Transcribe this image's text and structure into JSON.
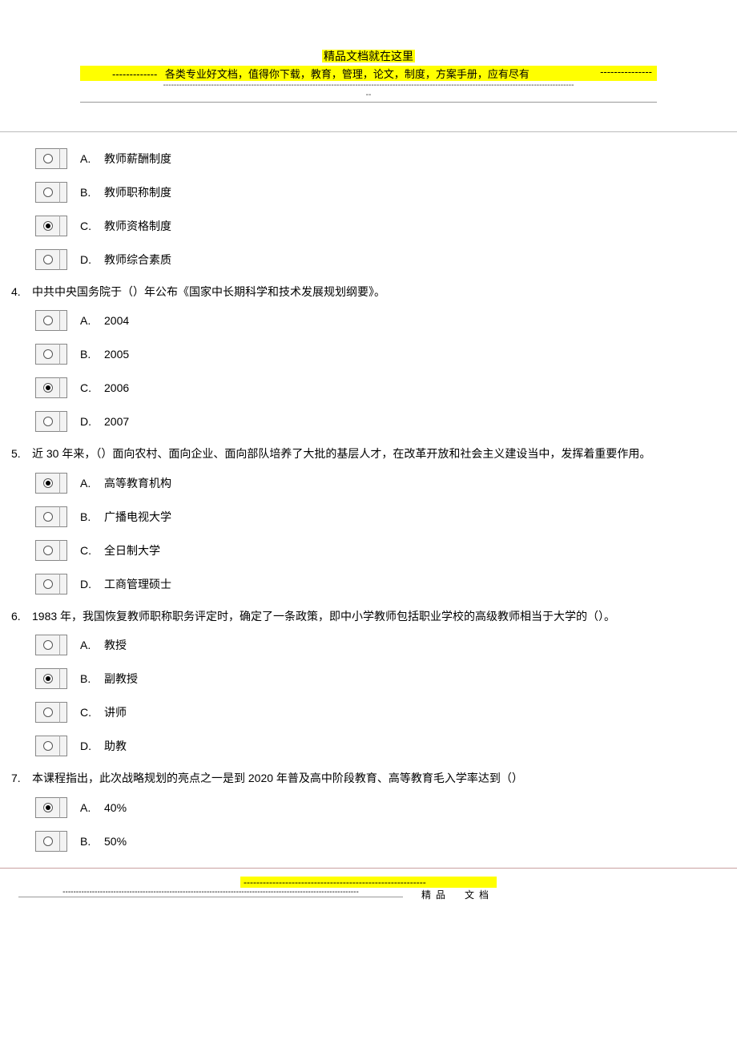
{
  "header": {
    "title": "精品文档就在这里",
    "dashes": "-------------",
    "sub": "各类专业好文档，值得你下载，教育，管理，论文，制度，方案手册，应有尽有",
    "dashes2": "---------------",
    "dotted": "----------------------------------------------------------------------------------------------------------------------------------------------------------",
    "dotted_tail": "--"
  },
  "questions": [
    {
      "num": "",
      "text": "",
      "options": [
        {
          "letter": "A.",
          "text": "教师薪酬制度",
          "selected": false
        },
        {
          "letter": "B.",
          "text": "教师职称制度",
          "selected": false
        },
        {
          "letter": "C.",
          "text": "教师资格制度",
          "selected": true
        },
        {
          "letter": "D.",
          "text": "教师综合素质",
          "selected": false
        }
      ]
    },
    {
      "num": "4.",
      "text": "中共中央国务院于（）年公布《国家中长期科学和技术发展规划纲要》。",
      "options": [
        {
          "letter": "A.",
          "text": "2004",
          "selected": false
        },
        {
          "letter": "B.",
          "text": "2005",
          "selected": false
        },
        {
          "letter": "C.",
          "text": "2006",
          "selected": true
        },
        {
          "letter": "D.",
          "text": "2007",
          "selected": false
        }
      ]
    },
    {
      "num": "5.",
      "text": "近 30 年来，（）面向农村、面向企业、面向部队培养了大批的基层人才，在改革开放和社会主义建设当中，发挥着重要作用。",
      "options": [
        {
          "letter": "A.",
          "text": "高等教育机构",
          "selected": true
        },
        {
          "letter": "B.",
          "text": "广播电视大学",
          "selected": false
        },
        {
          "letter": "C.",
          "text": "全日制大学",
          "selected": false
        },
        {
          "letter": "D.",
          "text": "工商管理硕士",
          "selected": false
        }
      ]
    },
    {
      "num": "6.",
      "text": "1983 年，我国恢复教师职称职务评定时，确定了一条政策，即中小学教师包括职业学校的高级教师相当于大学的（）。",
      "options": [
        {
          "letter": "A.",
          "text": "教授",
          "selected": false
        },
        {
          "letter": "B.",
          "text": "副教授",
          "selected": true
        },
        {
          "letter": "C.",
          "text": "讲师",
          "selected": false
        },
        {
          "letter": "D.",
          "text": "助教",
          "selected": false
        }
      ]
    },
    {
      "num": "7.",
      "text": "本课程指出，此次战略规划的亮点之一是到 2020 年普及高中阶段教育、高等教育毛入学率达到（）",
      "options": [
        {
          "letter": "A.",
          "text": "40%",
          "selected": true
        },
        {
          "letter": "B.",
          "text": "50%",
          "selected": false
        }
      ]
    }
  ],
  "footer": {
    "dashes": "---------------------------------------------------------",
    "label": "精品　文档",
    "dotted": "---------------------------------------------------------------------------------------------------------------"
  }
}
